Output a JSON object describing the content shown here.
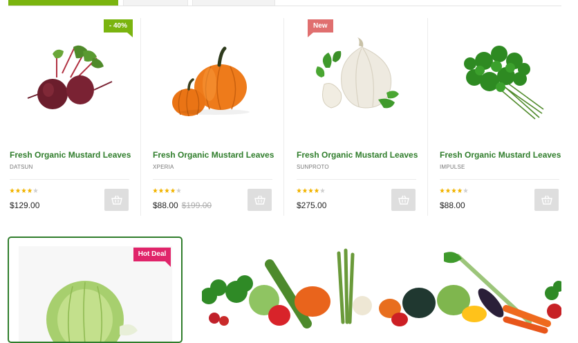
{
  "products": [
    {
      "title": "Fresh Organic Mustard Leaves",
      "brand": "DATSUN",
      "price": "$129.00",
      "old_price": "",
      "badge": "- 40%",
      "rating": 4,
      "image": "beetroot"
    },
    {
      "title": "Fresh Organic Mustard Leaves",
      "brand": "XPERIA",
      "price": "$88.00",
      "old_price": "$199.00",
      "badge": "",
      "rating": 4,
      "image": "pumpkin"
    },
    {
      "title": "Fresh Organic Mustard Leaves",
      "brand": "SUNPROTO",
      "price": "$275.00",
      "old_price": "",
      "badge": "New",
      "rating": 4,
      "image": "garlic"
    },
    {
      "title": "Fresh Organic Mustard Leaves",
      "brand": "IMPULSE",
      "price": "$88.00",
      "old_price": "",
      "badge": "",
      "rating": 4,
      "image": "parsley"
    }
  ],
  "deal": {
    "badge": "Hot Deal",
    "image": "cabbage"
  },
  "banner": {
    "image": "vegetables-row"
  },
  "icons": {
    "cart": "basket-icon",
    "star": "star-icon"
  },
  "colors": {
    "accent_green": "#7ab40f",
    "title_green": "#2f7d2b",
    "badge_new": "#e06f6f",
    "badge_hot": "#e0246a",
    "star_gold": "#f2b400"
  }
}
